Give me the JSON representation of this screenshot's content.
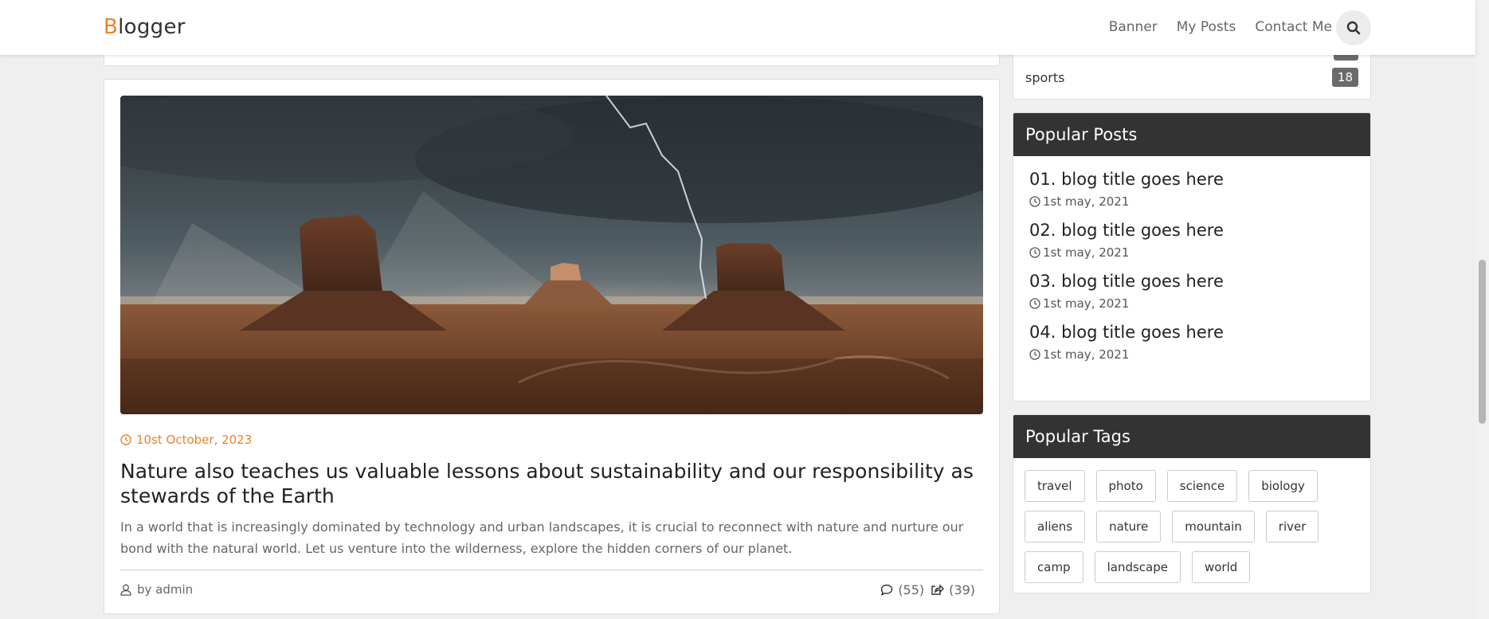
{
  "brand": {
    "first_letter": "B",
    "rest": "logger"
  },
  "nav": {
    "items": [
      "Banner",
      "My Posts",
      "Contact Me"
    ]
  },
  "categories": {
    "last_name": "sports",
    "last_count": "18"
  },
  "post": {
    "date": "10st October, 2023",
    "title": "Nature also teaches us valuable lessons about sustainability and our responsibility as stewards of the Earth",
    "excerpt": "In a world that is increasingly dominated by technology and urban landscapes, it is crucial to reconnect with nature and nurture our bond with the natural world. Let us venture into the wilderness, explore the hidden corners of our planet.",
    "author": "by admin",
    "comments": "(55)",
    "shares": "(39)"
  },
  "popular_posts": {
    "heading": "Popular Posts",
    "items": [
      {
        "title": "01. blog title goes here",
        "date": "1st may, 2021"
      },
      {
        "title": "02. blog title goes here",
        "date": "1st may, 2021"
      },
      {
        "title": "03. blog title goes here",
        "date": "1st may, 2021"
      },
      {
        "title": "04. blog title goes here",
        "date": "1st may, 2021"
      }
    ]
  },
  "popular_tags": {
    "heading": "Popular Tags",
    "tags": [
      "travel",
      "photo",
      "science",
      "biology",
      "aliens",
      "nature",
      "mountain",
      "river",
      "camp",
      "landscape",
      "world"
    ]
  },
  "colors": {
    "accent": "#e8832b",
    "widget_header": "#333333",
    "badge": "#6b6b6b"
  },
  "icons": {
    "search": "search-icon",
    "clock": "clock-icon",
    "user": "user-icon",
    "comment": "comment-icon",
    "share": "share-icon"
  }
}
